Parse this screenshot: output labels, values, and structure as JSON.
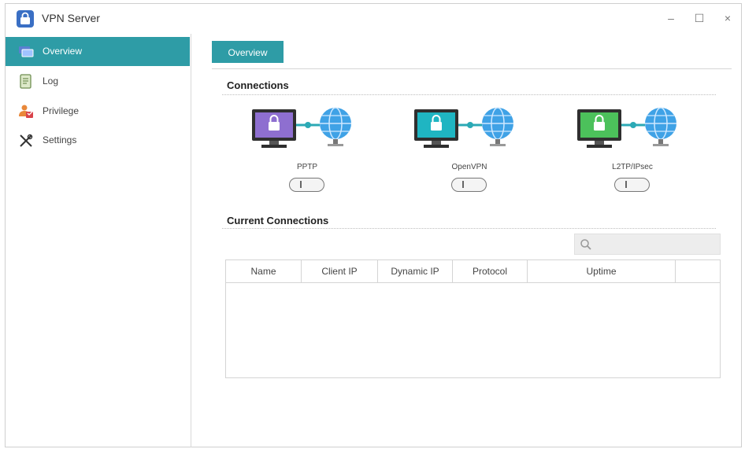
{
  "window": {
    "title": "VPN Server",
    "controls": {
      "minimize": "–",
      "maximize": "☐",
      "close": "×"
    }
  },
  "sidebar": {
    "items": [
      {
        "label": "Overview",
        "icon": "overview-icon",
        "active": true
      },
      {
        "label": "Log",
        "icon": "log-icon",
        "active": false
      },
      {
        "label": "Privilege",
        "icon": "privilege-icon",
        "active": false
      },
      {
        "label": "Settings",
        "icon": "settings-icon",
        "active": false
      }
    ]
  },
  "main": {
    "tabs": [
      {
        "label": "Overview",
        "active": true
      }
    ],
    "connections_title": "Connections",
    "protocols": [
      {
        "label": "PPTP",
        "color": "#8e6fd0"
      },
      {
        "label": "OpenVPN",
        "color": "#1fb5c2"
      },
      {
        "label": "L2TP/IPsec",
        "color": "#4cc15b"
      }
    ],
    "current_connections_title": "Current Connections",
    "search": {
      "placeholder": "",
      "value": ""
    },
    "table": {
      "columns": [
        "Name",
        "Client IP",
        "Dynamic IP",
        "Protocol",
        "Uptime",
        ""
      ],
      "rows": []
    }
  },
  "colors": {
    "accent": "#2e9ca6",
    "globe": "#3fa2e6"
  }
}
